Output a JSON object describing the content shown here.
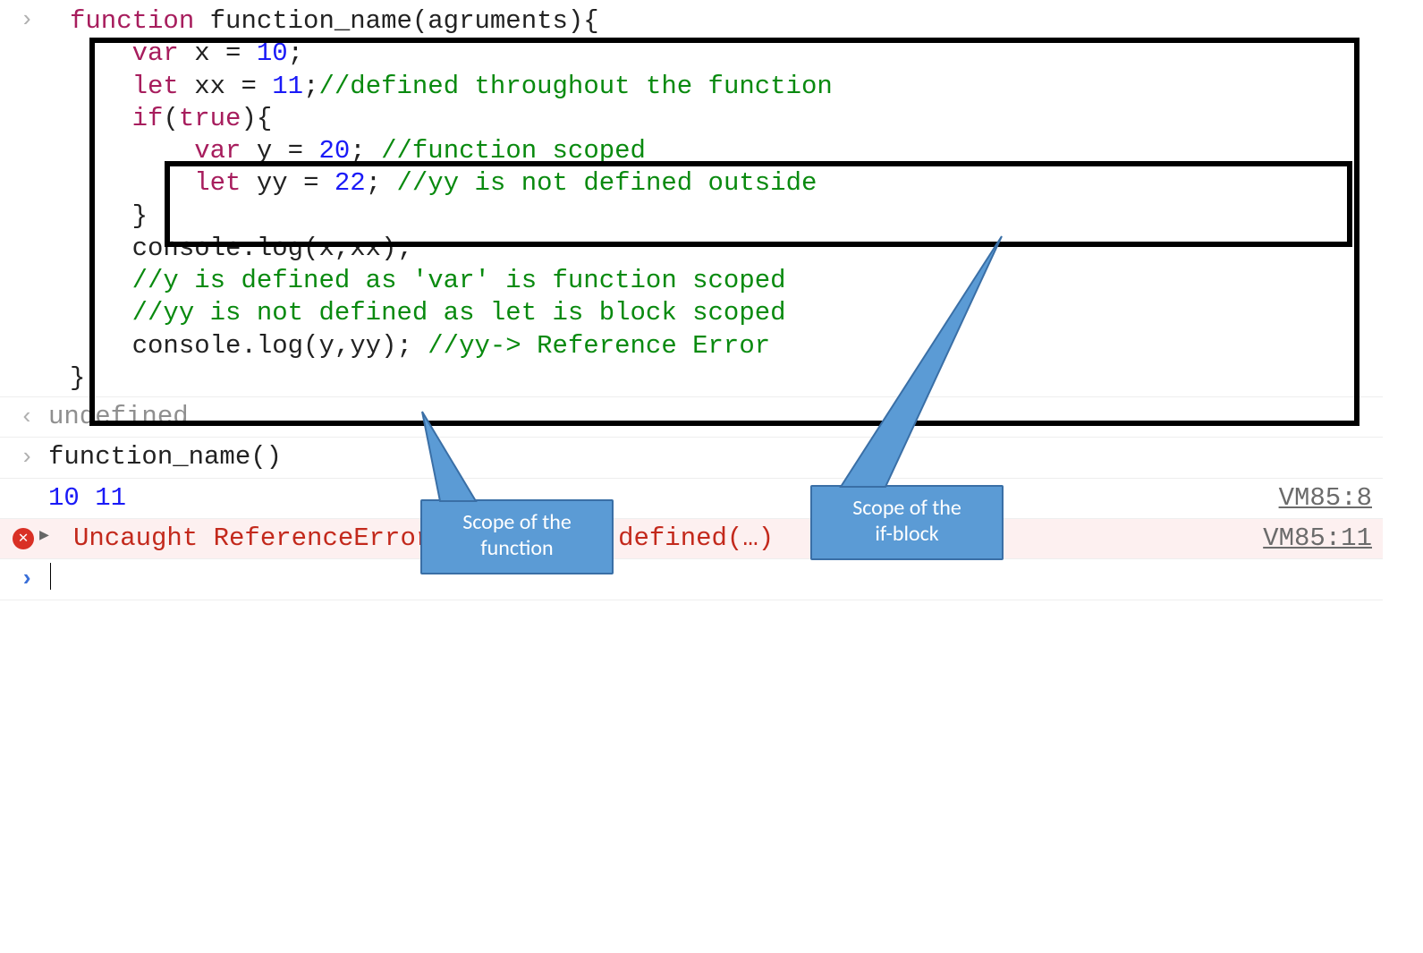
{
  "code": {
    "l1a": "function",
    "l1b": " function_name(agruments){",
    "l2a": "var",
    "l2b": " x = ",
    "l2c": "10",
    "l2d": ";",
    "l3a": "let",
    "l3b": " xx = ",
    "l3c": "11",
    "l3d": ";",
    "l3e": "//defined throughout the function",
    "l4a": "if",
    "l4b": "(",
    "l4c": "true",
    "l4d": "){",
    "l5a": "var",
    "l5b": " y = ",
    "l5c": "20",
    "l5d": "; ",
    "l5e": "//function scoped",
    "l6a": "let",
    "l6b": " yy = ",
    "l6c": "22",
    "l6d": "; ",
    "l6e": "//yy is not defined outside",
    "l7": "}",
    "l8": "console.log(x,xx);",
    "l9": "//y is defined as 'var' is function scoped",
    "l10": "//yy is not defined as let is block scoped",
    "l11a": "console.log(y,yy); ",
    "l11b": "//yy-> Reference Error",
    "l12": "}"
  },
  "out_undefined": "undefined",
  "call_line": "function_name()",
  "log_output": "10 11",
  "log_src": "VM85:8",
  "error_text": "Uncaught ReferenceError: yy is not defined(…)",
  "error_src": "VM85:11",
  "callouts": {
    "func": "Scope of the\nfunction",
    "ifblock": "Scope of the\nif-block"
  }
}
